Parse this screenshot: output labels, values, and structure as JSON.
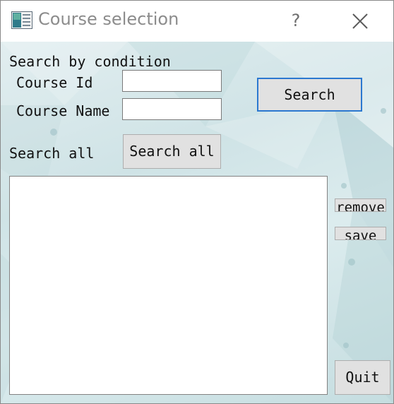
{
  "window": {
    "title": "Course selection",
    "help_label": "?",
    "close_icon": "close-icon",
    "app_icon": "app-form-icon"
  },
  "search_section": {
    "heading": "Search by condition",
    "course_id_label": "Course Id",
    "course_id_value": "",
    "course_name_label": "Course Name",
    "course_name_value": "",
    "search_button": "Search"
  },
  "search_all_section": {
    "label": "Search all",
    "button": "Search all"
  },
  "results": {
    "items": []
  },
  "actions": {
    "remove_button": "remove",
    "save_button": "save",
    "quit_button": "Quit"
  },
  "colors": {
    "accent_focus": "#2b78d0",
    "button_face": "#e1e1e1",
    "title_text": "#8c8c8c"
  }
}
